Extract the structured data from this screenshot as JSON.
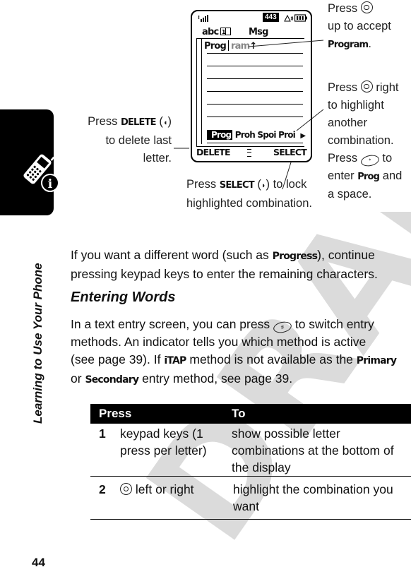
{
  "page": {
    "number": "44",
    "side_label": "Learning to Use Your Phone"
  },
  "phone_screen": {
    "status": {
      "signal_icon": "signal-strength-icon",
      "counter": "443",
      "ringer_icon": "ringer-icon",
      "battery_icon": "battery-icon"
    },
    "entry_indicator": "abc",
    "title": "Msg",
    "text_entered": "Prog",
    "text_suggested": "ram",
    "cursor_glyph": "↑",
    "combinations": [
      {
        "label": "Prog",
        "highlighted": true
      },
      {
        "label": "Proh",
        "highlighted": false
      },
      {
        "label": "Spoi",
        "highlighted": false
      },
      {
        "label": "Proi",
        "highlighted": false
      }
    ],
    "more_arrow": "▶",
    "softkey_left": "DELETE",
    "softkey_center_icon": "menu-icon",
    "softkey_right": "SELECT"
  },
  "callouts": {
    "top_right": {
      "line1": "Press",
      "line2": "up to accept",
      "keyword": "Program",
      "tail": "."
    },
    "right": {
      "line1a": "Press",
      "line1b": "right",
      "line2": "to highlight",
      "line3": "another",
      "line4": "combination.",
      "line5a": "Press",
      "line5b": "to",
      "line6a": "enter",
      "keyword": "Prog",
      "line6b": "and",
      "line7": "a space."
    },
    "left": {
      "line1a": "Press",
      "keyword": "DELETE",
      "line1b": "(",
      "line1c": ")",
      "line2": "to delete last",
      "line3": "letter."
    },
    "bottom": {
      "line1a": "Press",
      "keyword": "SELECT",
      "line1b": "(",
      "line1c": ") to lock",
      "line2": "highlighted combination."
    }
  },
  "body": {
    "para1_a": "If you want a different word (such as ",
    "para1_kw": "Progress",
    "para1_b": "), continue",
    "para1_line2": "pressing keypad keys to enter the remaining characters.",
    "heading": "Entering Words",
    "para2_l1a": "In a text entry screen, you can press",
    "para2_l1b": "to switch entry",
    "para2_l2": "methods. An indicator tells you which method is active",
    "para2_l3a": "(see page 39). If",
    "para2_kw1": "iTAP",
    "para2_l3b": "method is not available as the",
    "para2_kw2": "Primary",
    "para2_l4a": "or",
    "para2_kw3": "Secondary",
    "para2_l4b": "entry method, see page 39."
  },
  "table": {
    "headers": [
      "Press",
      "To"
    ],
    "rows": [
      {
        "num": "1",
        "press_l1": "keypad keys (1",
        "press_l2": "press per letter)",
        "to_l1": "show possible letter",
        "to_l2": "combinations at the bottom of",
        "to_l3": "the display"
      },
      {
        "num": "2",
        "press": "left or right",
        "to_l1": "highlight the combination you",
        "to_l2": "want"
      }
    ]
  },
  "watermark": "DRAFT"
}
